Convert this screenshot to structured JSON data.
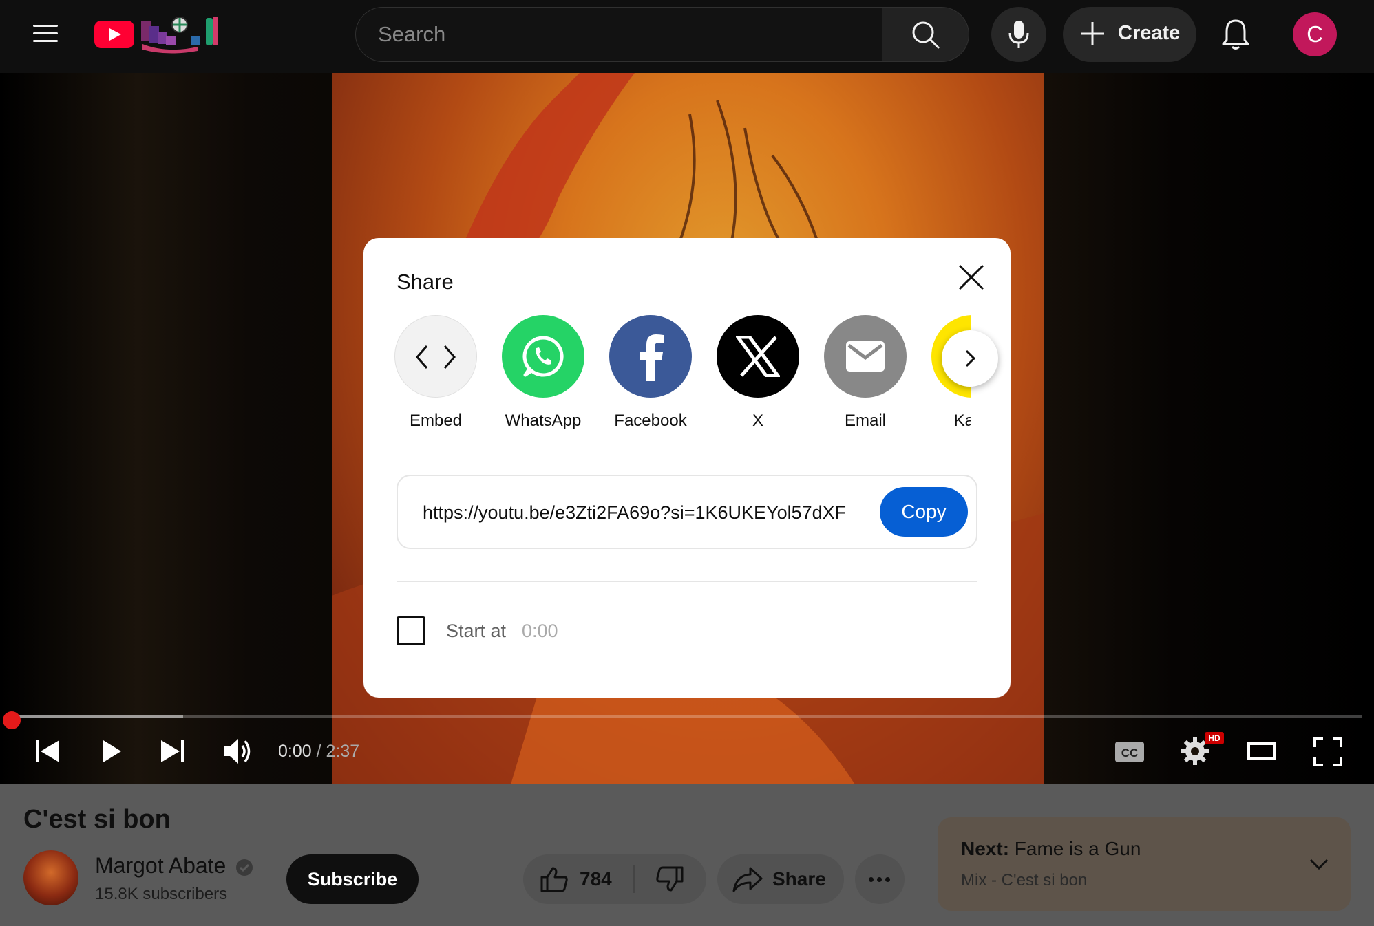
{
  "header": {
    "search_placeholder": "Search",
    "create_label": "Create",
    "avatar_initial": "C"
  },
  "player": {
    "current_time": "0:00",
    "separator": " / ",
    "duration": "2:37",
    "progress_fraction": 0.0,
    "quality_badge": "HD"
  },
  "video": {
    "title": "C'est si bon",
    "channel_name": "Margot Abate",
    "subscribers": "15.8K subscribers",
    "subscribe_label": "Subscribe",
    "like_count": "784",
    "share_label": "Share"
  },
  "next_up": {
    "prefix": "Next:",
    "title": "Fame is a Gun",
    "subtitle": "Mix - C'est si bon"
  },
  "share_dialog": {
    "title": "Share",
    "targets": [
      {
        "label": "Embed",
        "icon": "embed-icon",
        "color": "#f2f2f2"
      },
      {
        "label": "WhatsApp",
        "icon": "whatsapp-icon",
        "color": "#25d366"
      },
      {
        "label": "Facebook",
        "icon": "facebook-icon",
        "color": "#3b5998"
      },
      {
        "label": "X",
        "icon": "x-icon",
        "color": "#000000"
      },
      {
        "label": "Email",
        "icon": "email-icon",
        "color": "#888888"
      },
      {
        "label": "Kaka",
        "icon": "kakaotalk-icon",
        "color": "#fee500"
      }
    ],
    "url": "https://youtu.be/e3Zti2FA69o?si=1K6UKEYol57dXF",
    "copy_label": "Copy",
    "start_at_label": "Start at",
    "start_at_value": "0:00"
  },
  "colors": {
    "brand_red": "#ff0033",
    "copy_blue": "#065fd4",
    "avatar_pink": "#c2185b"
  }
}
